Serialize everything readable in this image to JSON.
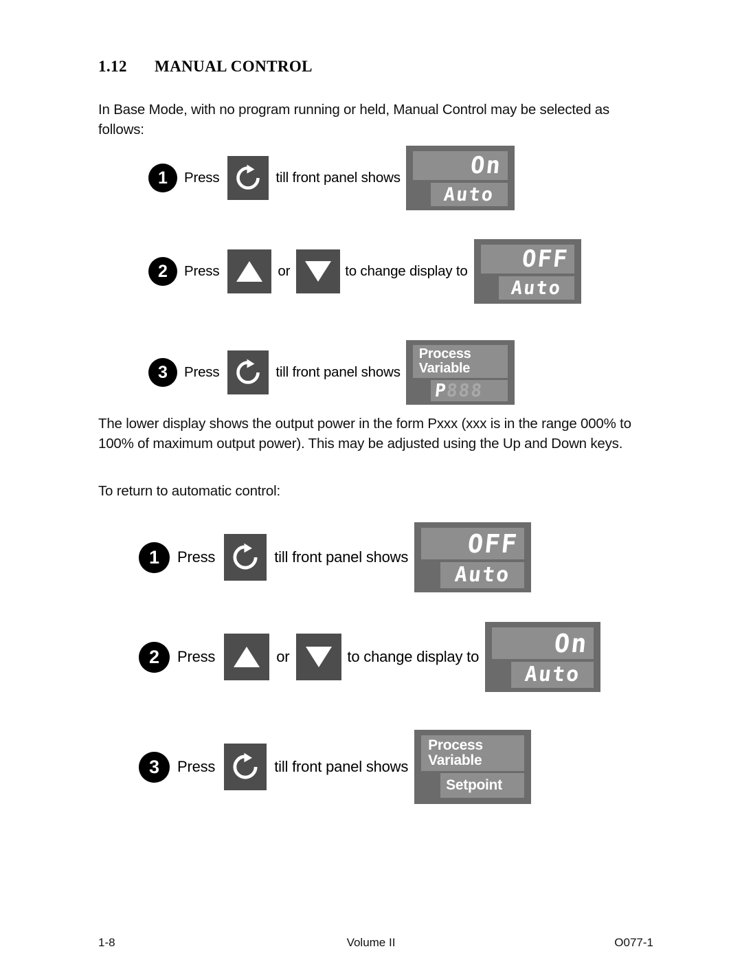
{
  "heading": {
    "number": "1.12",
    "title": "MANUAL CONTROL"
  },
  "paragraphs": {
    "intro": "In Base Mode, with no program running or held, Manual Control may be selected as follows:",
    "lower_display": "The lower display shows the output power in the form Pxxx (xxx is in the range 000% to 100% of maximum output power). This may be adjusted using the Up and Down keys.",
    "return_to_auto": "To return to automatic control:"
  },
  "labels": {
    "press": "Press",
    "or": "or",
    "till_front_panel_shows": "till front panel shows",
    "to_change_display_to": "to change display to"
  },
  "icons": {
    "scroll_key": "circular-arrow-icon",
    "up_key": "triangle-up-icon",
    "down_key": "triangle-down-icon"
  },
  "sequence_manual": [
    {
      "badge": "1",
      "press": "Press",
      "key": "scroll-key",
      "connector": "till front panel shows",
      "panel": {
        "upper_type": "segment",
        "upper": "On",
        "lower_type": "segment",
        "lower": "Auto"
      }
    },
    {
      "badge": "2",
      "press": "Press",
      "key": "up-down-keys",
      "or": "or",
      "connector": "to change display to",
      "panel": {
        "upper_type": "segment",
        "upper": "OFF",
        "lower_type": "segment",
        "lower": "Auto"
      }
    },
    {
      "badge": "3",
      "press": "Press",
      "key": "scroll-key",
      "connector": "till front panel shows",
      "panel": {
        "upper_type": "text",
        "upper": "Process\nVariable",
        "lower_type": "segment",
        "lower": "P",
        "lower_dim": "888"
      }
    }
  ],
  "sequence_auto": [
    {
      "badge": "1",
      "press": "Press",
      "key": "scroll-key",
      "connector": "till front panel shows",
      "panel": {
        "upper_type": "segment",
        "upper": "OFF",
        "lower_type": "segment",
        "lower": "Auto"
      }
    },
    {
      "badge": "2",
      "press": "Press",
      "key": "up-down-keys",
      "or": "or",
      "connector": "to change display to",
      "panel": {
        "upper_type": "segment",
        "upper": "On",
        "lower_type": "segment",
        "lower": "Auto"
      }
    },
    {
      "badge": "3",
      "press": "Press",
      "key": "scroll-key",
      "connector": "till front panel shows",
      "panel": {
        "upper_type": "text",
        "upper": "Process\nVariable",
        "lower_type": "text",
        "lower": "Setpoint"
      }
    }
  ],
  "footer": {
    "page": "1-8",
    "volume": "Volume II",
    "code": "O077-1"
  },
  "colors": {
    "panel_frame": "#6b6b6b",
    "panel_display": "#8e8e8e",
    "key_button": "#4d4d4d",
    "segment_lit": "#ffffff",
    "segment_unlit": "#a9a9a9",
    "badge": "#000000"
  }
}
